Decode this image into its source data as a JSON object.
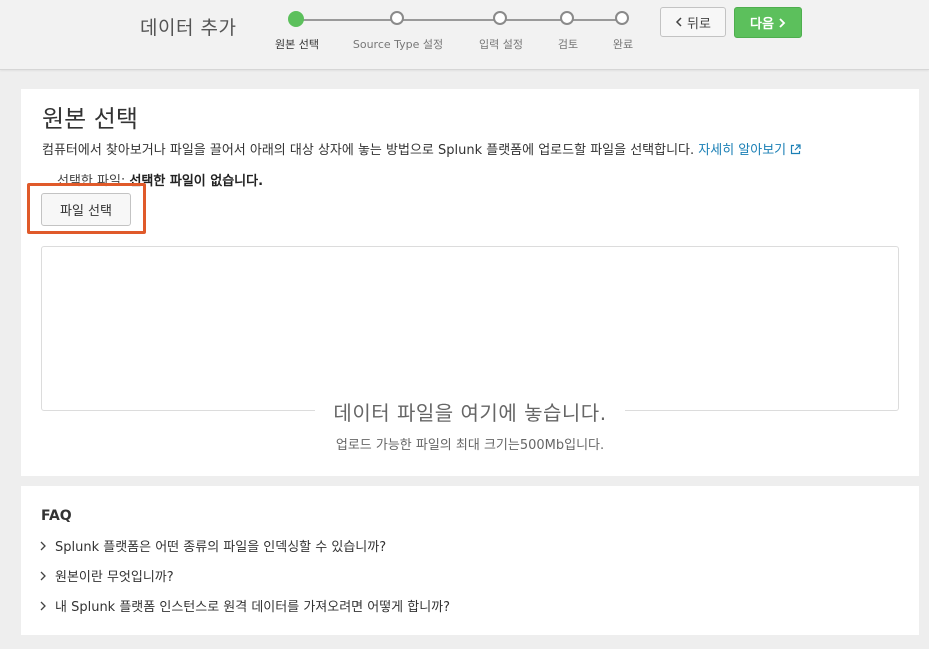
{
  "header": {
    "title": "데이터 추가",
    "steps": [
      {
        "label": "원본 선택",
        "active": true
      },
      {
        "label": "Source Type 설정",
        "active": false
      },
      {
        "label": "입력 설정",
        "active": false
      },
      {
        "label": "검토",
        "active": false
      },
      {
        "label": "완료",
        "active": false
      }
    ],
    "back_label": "뒤로",
    "next_label": "다음",
    "accent_color": "#5cc05c"
  },
  "main": {
    "title": "원본 선택",
    "description": "컴퓨터에서 찾아보거나 파일을 끌어서 아래의 대상 상자에 놓는 방법으로 Splunk 플랫폼에 업로드할 파일을 선택합니다.",
    "learn_more": "자세히 알아보기",
    "selected_file_label": "선택한 파일:",
    "selected_file_value": "선택한 파일이 없습니다.",
    "select_file_button": "파일 선택",
    "highlight_color": "#e05a2a",
    "drop_text": "데이터 파일을 여기에 놓습니다.",
    "drop_subtext": "업로드 가능한 파일의 최대 크기는500Mb입니다."
  },
  "faq": {
    "title": "FAQ",
    "items": [
      "Splunk 플랫폼은 어떤 종류의 파일을 인덱싱할 수 있습니까?",
      "원본이란 무엇입니까?",
      "내 Splunk 플랫폼 인스턴스로 원격 데이터를 가져오려면 어떻게 합니까?"
    ]
  }
}
